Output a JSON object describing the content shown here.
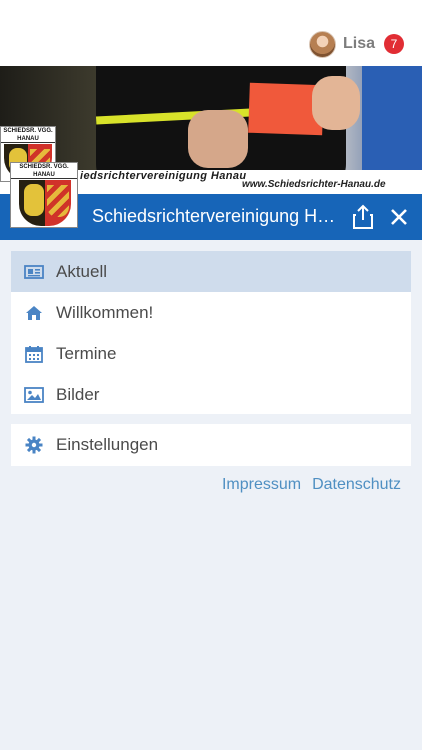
{
  "header": {
    "user_name": "Lisa",
    "notification_count": "7"
  },
  "banner": {
    "title_text": "iedsrichtervereinigung Hanau",
    "url_text": "www.Schiedsrichter-Hanau.de",
    "crest_small_lines": [
      "SCHIEDSR. VGG.",
      "HANAU"
    ],
    "crest_large_lines": [
      "SCHIEDSR. VGG.",
      "HANAU"
    ]
  },
  "appbar": {
    "title": "Schiedsrichtervereinigung Hanau"
  },
  "menu": {
    "items": [
      {
        "label": "Aktuell",
        "icon": "newspaper-icon",
        "active": true
      },
      {
        "label": "Willkommen!",
        "icon": "home-icon",
        "active": false
      },
      {
        "label": "Termine",
        "icon": "calendar-icon",
        "active": false
      },
      {
        "label": "Bilder",
        "icon": "image-icon",
        "active": false
      }
    ],
    "settings": {
      "label": "Einstellungen",
      "icon": "gear-icon"
    }
  },
  "footer": {
    "impressum": "Impressum",
    "datenschutz": "Datenschutz"
  },
  "colors": {
    "appbar": "#1765b8",
    "active_item": "#cfdcec",
    "icon": "#4a84c4",
    "link": "#4f8fc2",
    "badge": "#e12d34",
    "background": "#edf1f7"
  }
}
